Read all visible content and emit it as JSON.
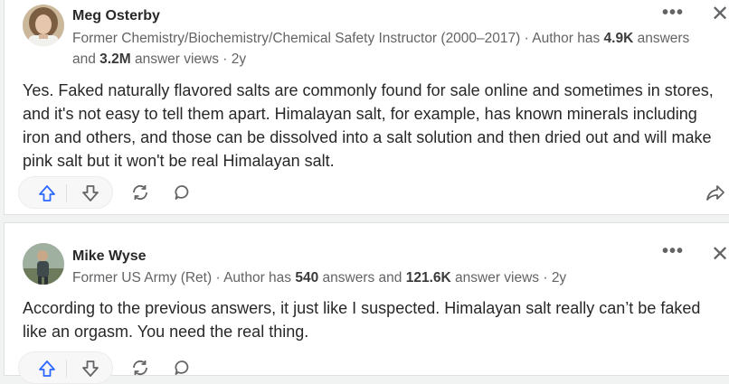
{
  "answers": [
    {
      "author": "Meg Osterby",
      "credential": "Former Chemistry/Biochemistry/Chemical Safety Instructor (2000–2017) · Author has ",
      "answers_count": "4.9K",
      "answers_word": " answers and ",
      "views_count": "3.2M",
      "views_word": " answer views · 2y",
      "text": "Yes. Faked naturally flavored salts are commonly found for sale online and sometimes in stores, and it's not easy to tell them apart. Himalayan salt, for example, has known minerals including iron and others, and those can be dissolved into a salt solution and then dried out and will make pink salt but it won't be real Himalayan salt."
    },
    {
      "author": "Mike Wyse",
      "credential": "Former US Army (Ret) · Author has ",
      "answers_count": "540",
      "answers_word": " answers and ",
      "views_count": "121.6K",
      "views_word": " answer views · 2y",
      "text": "According to the previous answers, it just like I suspected. Himalayan salt really can’t be faked like an orgasm. You need the real thing."
    }
  ],
  "icons": {
    "more": "more-options-icon",
    "close": "close-icon",
    "upvote": "upvote-arrow-icon",
    "downvote": "downvote-arrow-icon",
    "share": "reshare-icon",
    "comment": "comment-bubble-icon",
    "forward": "share-forward-icon"
  },
  "colors": {
    "upvote_blue": "#2e69ff",
    "muted": "#636466",
    "text": "#282829"
  },
  "glyphs": {
    "more": "•••",
    "close": "✕"
  }
}
